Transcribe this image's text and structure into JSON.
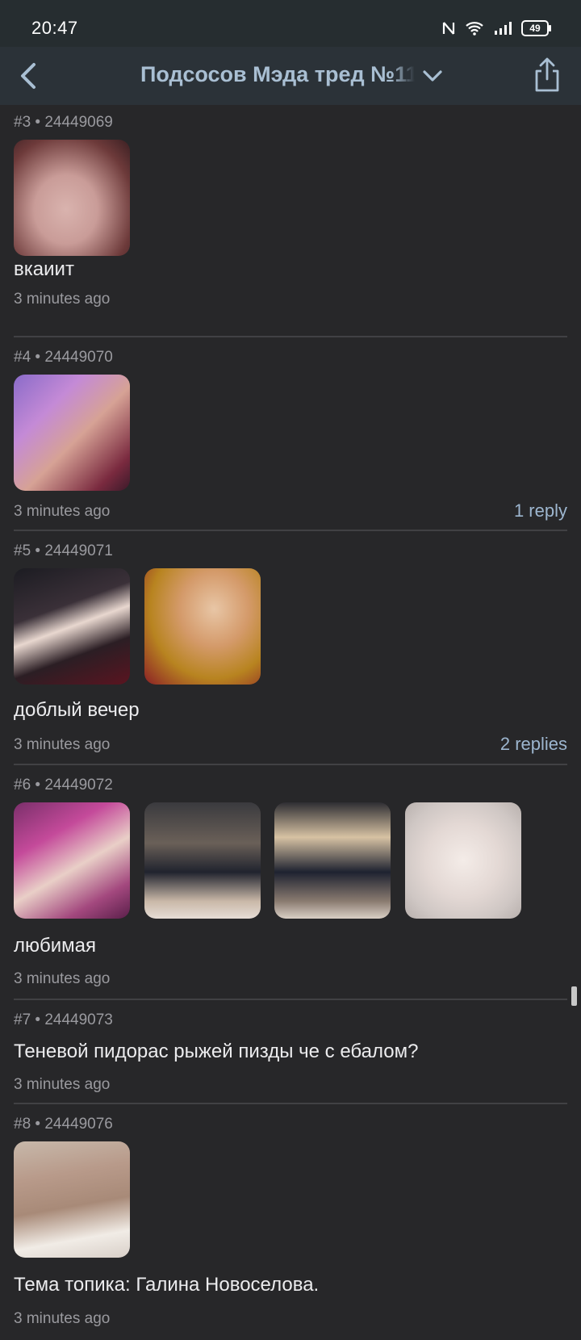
{
  "status_bar": {
    "time": "20:47",
    "battery": "49"
  },
  "nav": {
    "title": "Подсосов Мэда тред №11"
  },
  "colors": {
    "background": "#272729",
    "accent": "#9db6cf",
    "meta_text": "#9a9a9f"
  },
  "posts": [
    {
      "header": "#3 • 24449069",
      "text": "вкаиит",
      "time": "3 minutes ago",
      "replies": ""
    },
    {
      "header": "#4 • 24449070",
      "text": "",
      "time": "3 minutes ago",
      "replies": "1 reply"
    },
    {
      "header": "#5 • 24449071",
      "text": "доблый вечер",
      "time": "3 minutes ago",
      "replies": "2 replies"
    },
    {
      "header": "#6 • 24449072",
      "text": "любимая",
      "time": "3 minutes ago",
      "replies": ""
    },
    {
      "header": "#7 • 24449073",
      "text": "Теневой пидорас рыжей пизды че с ебалом?",
      "time": "3 minutes ago",
      "replies": ""
    },
    {
      "header": "#8 • 24449076",
      "text": "Тема топика: Галина Новоселова.",
      "time": "3 minutes ago",
      "replies": ""
    }
  ],
  "icons": {
    "back": "chevron-left-icon",
    "dropdown": "chevron-down-icon",
    "share": "share-icon",
    "wifi": "wifi-icon",
    "signal": "signal-icon",
    "nfc": "nfc-icon"
  }
}
